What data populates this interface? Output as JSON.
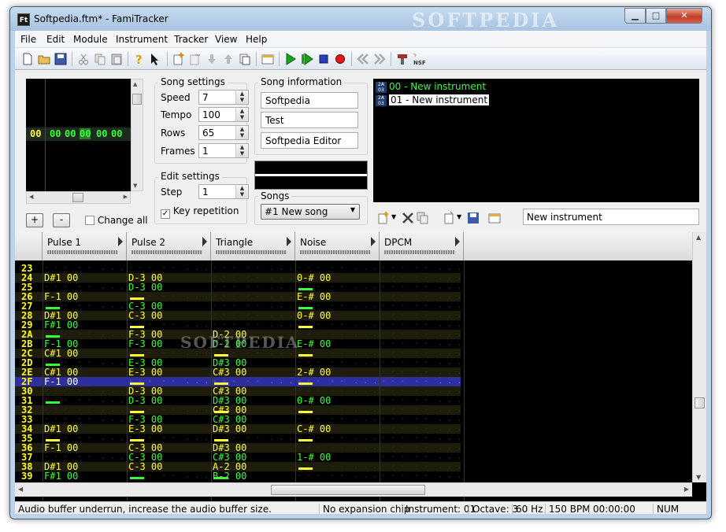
{
  "window": {
    "title": "Softpedia.ftm* - FamiTracker",
    "watermark": "SOFTPEDIA"
  },
  "menu": [
    "File",
    "Edit",
    "Module",
    "Instrument",
    "Tracker",
    "View",
    "Help"
  ],
  "toolbar_icons": [
    "new-file-icon",
    "open-folder-icon",
    "save-icon",
    "cut-icon",
    "copy-icon",
    "paste-icon",
    "help-icon",
    "context-help-icon",
    "insert-frame-icon",
    "remove-frame-icon",
    "move-frame-down-icon",
    "move-frame-up-icon",
    "duplicate-frame-icon",
    "module-properties-icon",
    "play-icon",
    "play-pattern-icon",
    "stop-icon",
    "record-icon",
    "previous-track-icon",
    "next-track-icon",
    "settings-icon",
    "export-nsf-icon"
  ],
  "frame_view": {
    "row_label": "00",
    "cells": [
      "00",
      "00",
      "00",
      "00",
      "00"
    ]
  },
  "song_settings": {
    "title": "Song settings",
    "speed_label": "Speed",
    "speed": "7",
    "tempo_label": "Tempo",
    "tempo": "100",
    "rows_label": "Rows",
    "rows": "65",
    "frames_label": "Frames",
    "frames": "1"
  },
  "edit_settings": {
    "title": "Edit settings",
    "step_label": "Step",
    "step": "1",
    "key_repetition_label": "Key repetition",
    "key_repetition_checked": true
  },
  "frame_buttons": {
    "add": "+",
    "remove": "-",
    "change_all_label": "Change all",
    "change_all_checked": false
  },
  "song_info": {
    "title": "Song information",
    "name": "Softpedia",
    "artist": "Test",
    "copyright": "Softpedia Editor"
  },
  "songs": {
    "title": "Songs",
    "selected": "#1 New song"
  },
  "instruments": [
    {
      "label": "00 - New instrument",
      "color": "#33ff33",
      "selected": false
    },
    {
      "label": "01 - New instrument",
      "color": "#000000",
      "selected": true
    }
  ],
  "instrument_tag": {
    "top": "2A",
    "bottom": "03"
  },
  "instrument_name": "New instrument",
  "channels": [
    "Pulse 1",
    "Pulse 2",
    "Triangle",
    "Noise",
    "DPCM"
  ],
  "pattern": {
    "rows": [
      "23",
      "24",
      "25",
      "26",
      "27",
      "28",
      "29",
      "2A",
      "2B",
      "2C",
      "2D",
      "2E",
      "2F",
      "30",
      "31",
      "32",
      "33",
      "34",
      "35",
      "36",
      "37",
      "38",
      "39"
    ],
    "current_row": "2F",
    "cells": [
      [
        "",
        "",
        "",
        "",
        ""
      ],
      [
        "D#1 00",
        "D-3 00",
        "",
        "0-# 00",
        ""
      ],
      [
        "",
        "D-3 00",
        "",
        "",
        ""
      ],
      [
        "F-1 00",
        "",
        "",
        "E-# 00",
        ""
      ],
      [
        "",
        "C-3 00",
        "",
        "",
        ""
      ],
      [
        "D#1 00",
        "C-3 00",
        "",
        "0-# 00",
        ""
      ],
      [
        "F#1 00",
        "",
        "",
        "",
        ""
      ],
      [
        "",
        "F-3 00",
        "D-2 00",
        "",
        ""
      ],
      [
        "F-1 00",
        "F-3 00",
        "D-2 00",
        "E-# 00",
        ""
      ],
      [
        "C#1 00",
        "",
        "",
        "",
        ""
      ],
      [
        "",
        "E-3 00",
        "D#3 00",
        "",
        ""
      ],
      [
        "C#1 00",
        "E-3 00",
        "C#3 00",
        "2-# 00",
        ""
      ],
      [
        "F-1 00",
        "",
        "",
        "",
        ""
      ],
      [
        "",
        "D-3 00",
        "C#3 00",
        "",
        ""
      ],
      [
        "",
        "D-3 00",
        "D#3 00",
        "0-# 00",
        ""
      ],
      [
        "",
        "",
        "C#3 00",
        "",
        ""
      ],
      [
        "",
        "F-3 00",
        "C#3 00",
        "",
        ""
      ],
      [
        "D#1 00",
        "E-3 00",
        "D#3 00",
        "C-# 00",
        ""
      ],
      [
        "",
        "",
        "",
        "",
        ""
      ],
      [
        "F-1 00",
        "C-3 00",
        "D#3 00",
        "",
        ""
      ],
      [
        "",
        "C-3 00",
        "C#3 00",
        "1-# 00",
        ""
      ],
      [
        "D#1 00",
        "C-3 00",
        "A-2 00",
        "",
        ""
      ],
      [
        "F#1 00",
        "",
        "B-2 00",
        "",
        ""
      ]
    ],
    "note_cuts": [
      [
        false,
        false,
        false,
        false,
        false
      ],
      [
        false,
        false,
        false,
        false,
        false
      ],
      [
        false,
        false,
        false,
        true,
        false
      ],
      [
        false,
        true,
        false,
        false,
        false
      ],
      [
        true,
        false,
        false,
        true,
        false
      ],
      [
        false,
        false,
        false,
        false,
        false
      ],
      [
        false,
        true,
        false,
        true,
        false
      ],
      [
        true,
        false,
        false,
        false,
        false
      ],
      [
        false,
        false,
        false,
        false,
        false
      ],
      [
        false,
        true,
        true,
        true,
        false
      ],
      [
        true,
        false,
        false,
        false,
        false
      ],
      [
        false,
        false,
        false,
        false,
        false
      ],
      [
        false,
        true,
        true,
        true,
        false
      ],
      [
        false,
        false,
        false,
        false,
        false
      ],
      [
        true,
        false,
        false,
        false,
        false
      ],
      [
        false,
        true,
        true,
        true,
        false
      ],
      [
        false,
        false,
        false,
        false,
        false
      ],
      [
        false,
        false,
        false,
        false,
        false
      ],
      [
        true,
        true,
        true,
        true,
        false
      ],
      [
        false,
        false,
        false,
        false,
        false
      ],
      [
        false,
        false,
        false,
        false,
        false
      ],
      [
        false,
        false,
        false,
        true,
        false
      ],
      [
        false,
        true,
        true,
        false,
        false
      ]
    ]
  },
  "status": {
    "message": "Audio buffer underrun, increase the audio buffer size.",
    "expansion": "No expansion chip",
    "instrument": "Instrument: 01",
    "octave": "Octave: 3",
    "rate": "60 Hz",
    "bpm": "150 BPM",
    "time": "00:00:00",
    "num": "NUM"
  },
  "colors": {
    "note": "#ffff33",
    "note_alt": "#33ff33",
    "highlight": "#2e2e9e",
    "background": "#000000"
  }
}
